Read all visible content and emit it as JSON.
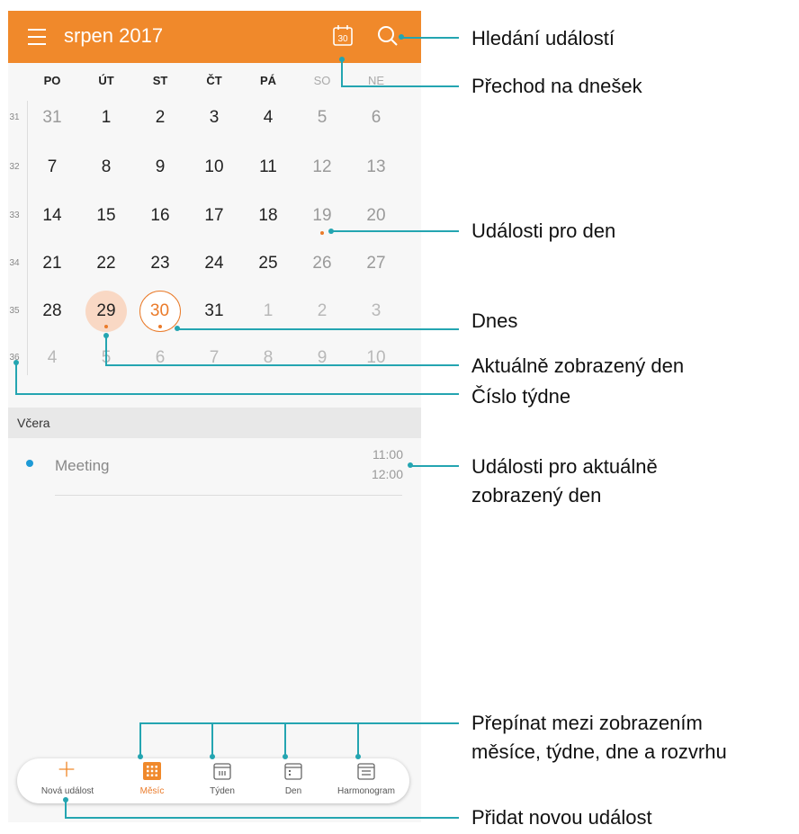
{
  "header": {
    "title": "srpen 2017",
    "today_icon_number": "30",
    "accent": "#f0892b"
  },
  "weekdays": [
    "PO",
    "ÚT",
    "ST",
    "ČT",
    "PÁ",
    "SO",
    "NE"
  ],
  "weeks": [
    {
      "num": "31",
      "days": [
        "31",
        "1",
        "2",
        "3",
        "4",
        "5",
        "6"
      ]
    },
    {
      "num": "32",
      "days": [
        "7",
        "8",
        "9",
        "10",
        "11",
        "12",
        "13"
      ]
    },
    {
      "num": "33",
      "days": [
        "14",
        "15",
        "16",
        "17",
        "18",
        "19",
        "20"
      ]
    },
    {
      "num": "34",
      "days": [
        "21",
        "22",
        "23",
        "24",
        "25",
        "26",
        "27"
      ]
    },
    {
      "num": "35",
      "days": [
        "28",
        "29",
        "30",
        "31",
        "1",
        "2",
        "3"
      ]
    },
    {
      "num": "36",
      "days": [
        "4",
        "5",
        "6",
        "7",
        "8",
        "9",
        "10"
      ]
    }
  ],
  "events_section": {
    "label": "Včera"
  },
  "event": {
    "title": "Meeting",
    "start": "11:00",
    "end": "12:00"
  },
  "bottom_nav": {
    "new_event": "Nová událost",
    "month": "Měsíc",
    "week": "Týden",
    "day": "Den",
    "schedule": "Harmonogram"
  },
  "callouts": {
    "search": "Hledání událostí",
    "today": "Přechod na dnešek",
    "day_events": "Události pro den",
    "now": "Dnes",
    "current_day": "Aktuálně zobrazený den",
    "week_number": "Číslo týdne",
    "events_current_1": "Události pro aktuálně",
    "events_current_2": "zobrazený den",
    "switch_1": "Přepínat mezi zobrazením",
    "switch_2": "měsíce, týdne, dne a rozvrhu",
    "add": "Přidat novou událost"
  },
  "colors": {
    "callout": "#24a5b1",
    "event_dot": "#1e9ad6",
    "today_ring": "#ea7b2a"
  }
}
